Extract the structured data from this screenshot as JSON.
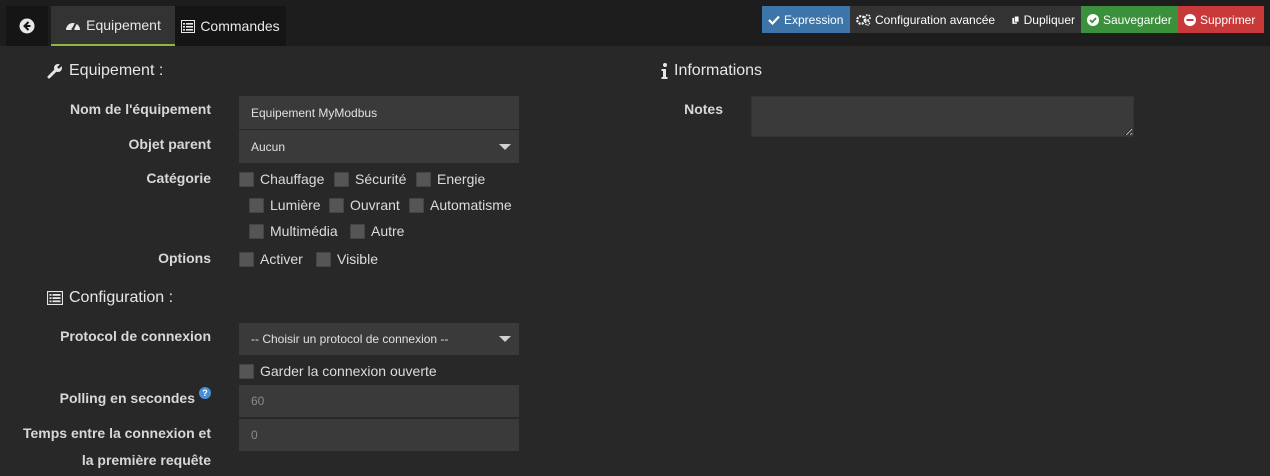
{
  "tabs": {
    "equipment": "Equipement",
    "commands": "Commandes"
  },
  "actions": {
    "expression": "Expression",
    "advanced_config": "Configuration avancée",
    "duplicate": "Dupliquer",
    "save": "Sauvegarder",
    "delete": "Supprimer"
  },
  "colors": {
    "expression": "#3d75a8",
    "save": "#3a903b",
    "delete": "#c8393a",
    "active_tab_border": "#94b447"
  },
  "equipment_section": {
    "title": "Equipement :",
    "name_label": "Nom de l'équipement",
    "name_value": "Equipement MyModbus",
    "parent_label": "Objet parent",
    "parent_value": "Aucun",
    "category_label": "Catégorie",
    "categories": [
      "Chauffage",
      "Sécurité",
      "Energie",
      "Lumière",
      "Ouvrant",
      "Automatisme",
      "Multimédia",
      "Autre"
    ],
    "options_label": "Options",
    "options": [
      "Activer",
      "Visible"
    ]
  },
  "config_section": {
    "title": "Configuration :",
    "protocol_label": "Protocol de connexion",
    "protocol_value": "-- Choisir un protocol de connexion --",
    "keep_open_label": "Garder la connexion ouverte",
    "polling_label": "Polling en secondes",
    "polling_value": "60",
    "delay_label_line1": "Temps entre la connexion et",
    "delay_label_line2": "la première requête",
    "delay_value": "0"
  },
  "info_section": {
    "title": "Informations",
    "notes_label": "Notes",
    "notes_value": ""
  }
}
